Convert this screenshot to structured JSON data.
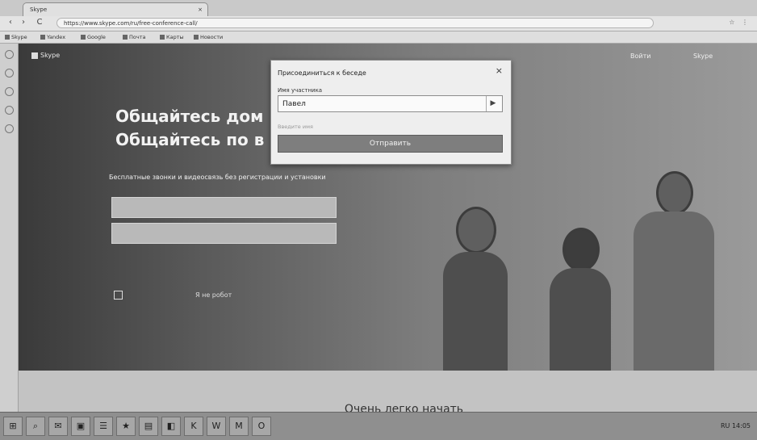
{
  "browser": {
    "tab_title": "Skype",
    "tab_close": "×",
    "url": "https://www.skype.com/ru/free-conference-call/",
    "toolbar_icons": "☆ ⋮",
    "nav_back": "‹",
    "nav_forward": "›",
    "nav_reload": "C",
    "bookmarks": [
      "Skype",
      "Yandex",
      "Google",
      "Почта",
      "Карты",
      "Новости"
    ]
  },
  "site": {
    "header_right": [
      "Войти",
      "Skype"
    ],
    "hero_title_line1": "Общайтесь дом",
    "hero_title_line2": "Общайтесь по в",
    "hero_subtitle": "Бесплатные звонки и видеосвязь без регистрации и установки",
    "checkbox_text": "Я не робот",
    "bottom_text": "Очень легко начать"
  },
  "modal": {
    "title": "Присоединиться к беседе",
    "close": "×",
    "label": "Имя участника",
    "input_value": "Павел",
    "input_side": "▶",
    "hint": "Введите имя",
    "button": "Отправить"
  },
  "taskbar": {
    "buttons": [
      "⊞",
      "⌕",
      "✉",
      "▣",
      "☰",
      "★",
      "▤",
      "◧",
      "K",
      "W",
      "M",
      "O"
    ],
    "tray": "RU 14:05"
  }
}
